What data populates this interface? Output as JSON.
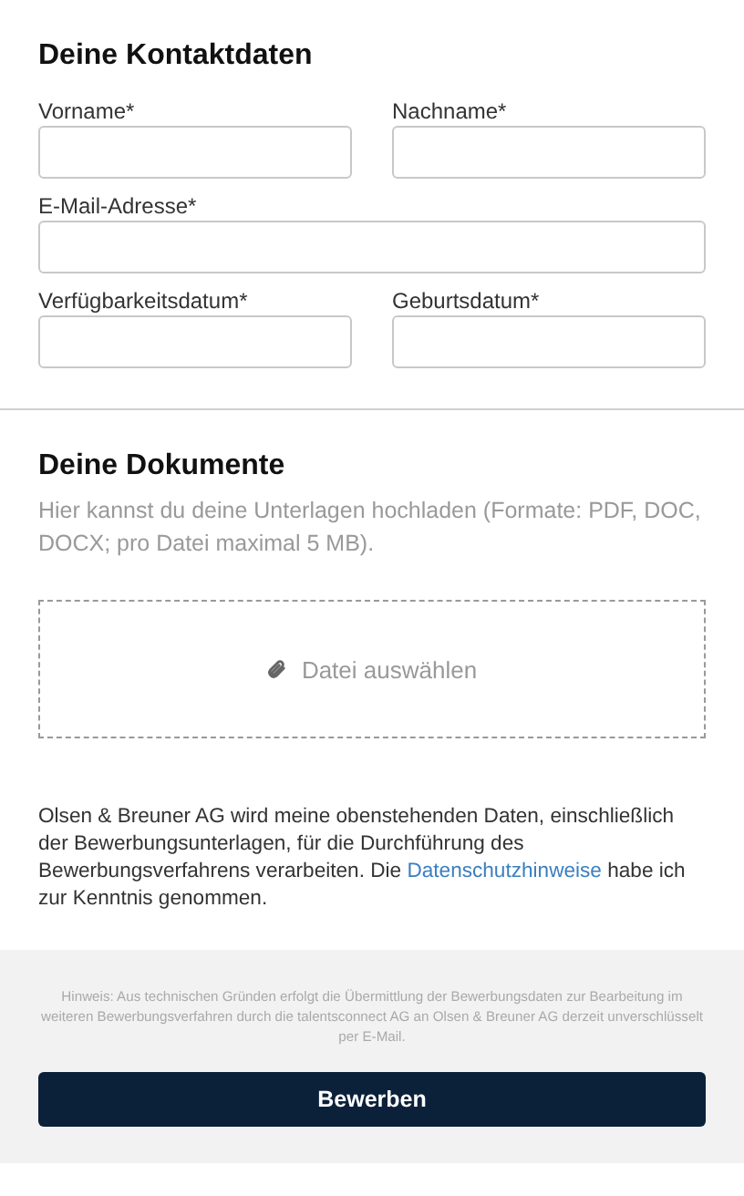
{
  "contact": {
    "title": "Deine Kontaktdaten",
    "rows": [
      {
        "fields": [
          {
            "label": "Vorname*"
          },
          {
            "label": "Nachname*"
          }
        ]
      },
      {
        "fields": [
          {
            "label": "E-Mail-Adresse*"
          }
        ]
      },
      {
        "fields": [
          {
            "label": "Verfügbarkeitsdatum*"
          },
          {
            "label": "Geburtsdatum*"
          }
        ]
      }
    ]
  },
  "documents": {
    "title": "Deine Dokumente",
    "hint": "Hier kannst du deine Unterlagen hochladen (Formate: PDF, DOC, DOCX; pro Datei maximal 5 MB).",
    "upload_label": "Datei auswählen"
  },
  "consent": {
    "before": "Olsen & Breuner AG wird meine obenstehenden Daten, einschließlich der Bewerbungsunterlagen, für die Durchführung des Bewerbungsverfahrens verarbeiten. Die ",
    "link": "Datenschutzhinweise",
    "after": " habe ich zur Kenntnis genommen."
  },
  "footer": {
    "note": "Hinweis: Aus technischen Gründen erfolgt die Übermittlung der Bewerbungsdaten zur Bearbeitung im weiteren Bewerbungsverfahren durch die talentsconnect AG an Olsen & Breuner AG derzeit unverschlüsselt per E-Mail.",
    "button": "Bewerben"
  }
}
